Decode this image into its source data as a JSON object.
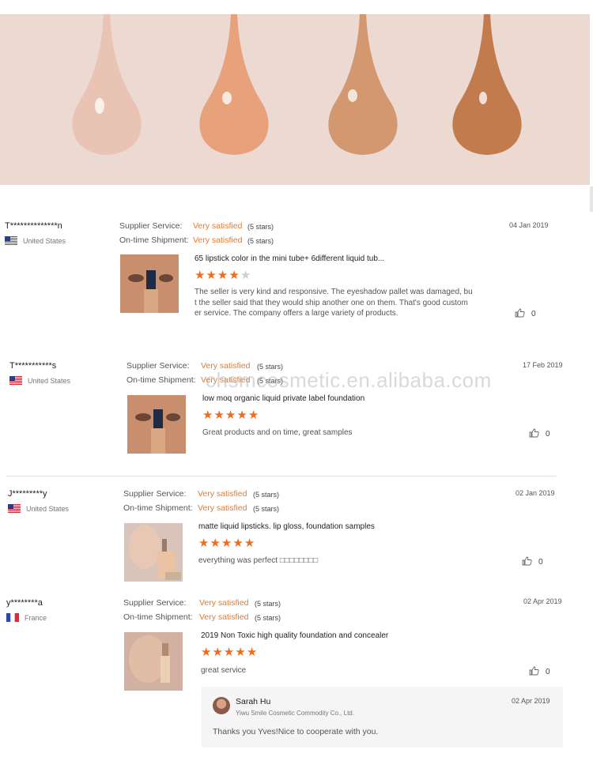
{
  "watermark": "chsmcosmetic.en.alibaba.com",
  "banner": {
    "drop_colors": [
      "#e9c3b4",
      "#e7a27c",
      "#d49871",
      "#c17b4c"
    ]
  },
  "labels": {
    "supplier_service": "Supplier Service:",
    "ontime_shipment": "On-time Shipment:"
  },
  "reviews": [
    {
      "user": "T**************n",
      "country": "United States",
      "flag": "us",
      "supplier_rating": "Very satisfied",
      "supplier_stars": "(5 stars)",
      "shipment_rating": "Very satisfied",
      "shipment_stars": "(5 stars)",
      "date": "04 Jan 2019",
      "product": "65 lipstick color in the mini tube+ 6different liquid tub...",
      "rating": 4,
      "comment_lines": [
        "The seller is very kind and responsive. The eyeshadow pallet was damaged, bu",
        "t the seller said that they would ship another one on them. That's good custom",
        "er service. The company offers a large variety of products."
      ],
      "likes": "0"
    },
    {
      "user": "T***********s",
      "country": "United States",
      "flag": "us",
      "supplier_rating": "Very satisfied",
      "supplier_stars": "(5 stars)",
      "shipment_rating": "Very satisfied",
      "shipment_stars": "(5 stars)",
      "date": "17 Feb 2019",
      "product": "low moq organic liquid private label foundation",
      "rating": 5,
      "comment_lines": [
        "Great products and on time, great samples"
      ],
      "likes": "0"
    },
    {
      "user": "J*********y",
      "country": "United States",
      "flag": "us",
      "supplier_rating": "Very satisfied",
      "supplier_stars": "(5 stars)",
      "shipment_rating": "Very satisfied",
      "shipment_stars": "(5 stars)",
      "date": "02 Jan 2019",
      "product": "matte liquid lipsticks. lip gloss, foundation samples",
      "rating": 5,
      "comment_lines": [
        "everything was perfect □□□□□□□□"
      ],
      "likes": "0"
    },
    {
      "user": "y********a",
      "country": "France",
      "flag": "fr",
      "supplier_rating": "Very satisfied",
      "supplier_stars": "(5 stars)",
      "shipment_rating": "Very satisfied",
      "shipment_stars": "(5 stars)",
      "date": "02 Apr 2019",
      "product": "2019 Non Toxic high quality foundation and concealer",
      "rating": 5,
      "comment_lines": [
        "great service"
      ],
      "likes": "0"
    }
  ],
  "reply": {
    "name": "Sarah Hu",
    "company": "Yiwu Smile Cosmetic Commodity Co., Ltd.",
    "date": "02 Apr 2019",
    "text": "Thanks you Yves!Nice to cooperate with you."
  }
}
